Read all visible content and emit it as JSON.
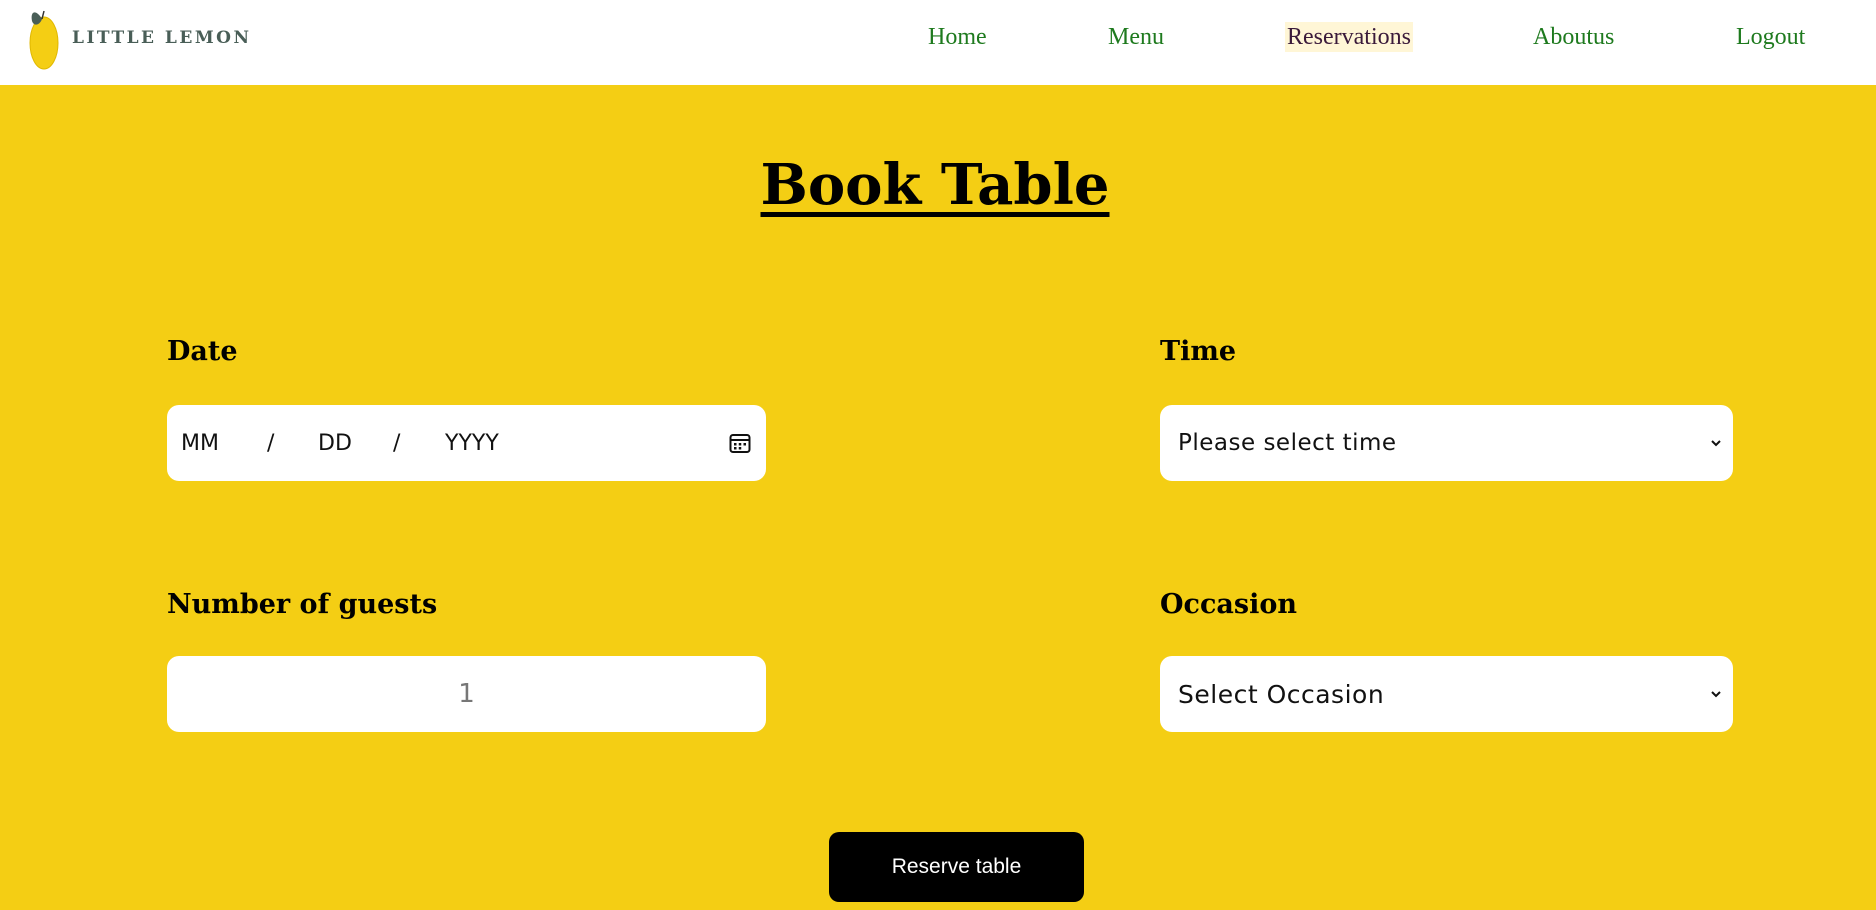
{
  "header": {
    "logo_text": "LITTLE LEMON",
    "nav": [
      {
        "label": "Home"
      },
      {
        "label": "Menu"
      },
      {
        "label": "Reservations",
        "active": true
      },
      {
        "label": "Aboutus"
      },
      {
        "label": "Logout"
      }
    ]
  },
  "main": {
    "title": "Book Table",
    "date": {
      "label": "Date",
      "month_placeholder": "MM",
      "day_placeholder": "DD",
      "year_placeholder": "YYYY",
      "separator": "/",
      "icon": "calendar-icon"
    },
    "time": {
      "label": "Time",
      "selected": "Please select time",
      "icon": "chevron-down-icon"
    },
    "guests": {
      "label": "Number of guests",
      "value": "1"
    },
    "occasion": {
      "label": "Occasion",
      "selected": "Select Occasion",
      "icon": "chevron-down-icon"
    },
    "submit_label": "Reserve table"
  },
  "colors": {
    "background": "#F4CE14",
    "header_bg": "#FFFFFF",
    "nav_link": "#1E7A1E",
    "button_bg": "#000000",
    "button_text": "#FFFFFF",
    "logo_text": "#495E57"
  }
}
